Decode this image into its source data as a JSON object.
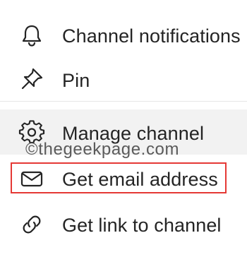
{
  "menu": {
    "items": [
      {
        "label": "Channel notifications",
        "icon": "bell-icon"
      },
      {
        "label": "Pin",
        "icon": "pin-icon"
      },
      {
        "label": "Manage channel",
        "icon": "gear-icon"
      },
      {
        "label": "Get email address",
        "icon": "mail-icon"
      },
      {
        "label": "Get link to channel",
        "icon": "link-icon"
      }
    ]
  },
  "watermark": "©thegeekpage.com",
  "colors": {
    "text": "#242424",
    "hover_background": "#f2f2f2",
    "highlight_border": "#e53935",
    "watermark": "#5a5a5a"
  }
}
